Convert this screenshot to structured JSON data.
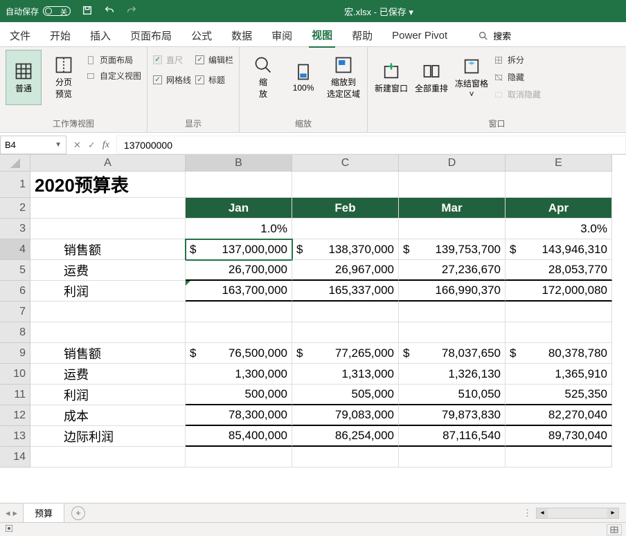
{
  "titleBar": {
    "autoSave": "自动保存",
    "autoSaveState": "关",
    "fileName": "宏.xlsx",
    "savedState": "已保存"
  },
  "tabs": {
    "items": [
      "文件",
      "开始",
      "插入",
      "页面布局",
      "公式",
      "数据",
      "审阅",
      "视图",
      "帮助",
      "Power Pivot"
    ],
    "activeIndex": 7,
    "searchLabel": "搜索"
  },
  "ribbon": {
    "workbookViews": {
      "normal": "普通",
      "pageBreak": "分页\n预览",
      "pageLayout": "页面布局",
      "customViews": "自定义视图",
      "groupLabel": "工作簿视图"
    },
    "show": {
      "ruler": "直尺",
      "formulaBar": "编辑栏",
      "gridlines": "网格线",
      "headings": "标题",
      "groupLabel": "显示"
    },
    "zoom": {
      "zoom": "缩\n放",
      "hundred": "100%",
      "toSelection": "缩放到\n选定区域",
      "groupLabel": "缩放"
    },
    "window": {
      "newWindow": "新建窗口",
      "arrangeAll": "全部重排",
      "freezePanes": "冻结窗格",
      "split": "拆分",
      "hide": "隐藏",
      "unhide": "取消隐藏",
      "groupLabel": "窗口"
    }
  },
  "formulaBar": {
    "nameBox": "B4",
    "formula": "137000000"
  },
  "grid": {
    "columns": [
      "A",
      "B",
      "C",
      "D",
      "E"
    ],
    "title": "2020预算表",
    "months": [
      "Jan",
      "Feb",
      "Mar",
      "Apr"
    ],
    "rowLabels": {
      "sales": "销售额",
      "shipping": "运费",
      "profit": "利润",
      "cost": "成本",
      "marginProfit": "边际利润"
    },
    "percents": {
      "B3": "1.0%",
      "E3": "3.0%"
    },
    "block1": {
      "sales": [
        "137,000,000",
        "138,370,000",
        "139,753,700",
        "143,946,310"
      ],
      "shipping": [
        "26,700,000",
        "26,967,000",
        "27,236,670",
        "28,053,770"
      ],
      "profit": [
        "163,700,000",
        "165,337,000",
        "166,990,370",
        "172,000,080"
      ]
    },
    "block2": {
      "sales": [
        "76,500,000",
        "77,265,000",
        "78,037,650",
        "80,378,780"
      ],
      "shipping": [
        "1,300,000",
        "1,313,000",
        "1,326,130",
        "1,365,910"
      ],
      "profit": [
        "500,000",
        "505,000",
        "510,050",
        "525,350"
      ],
      "cost": [
        "78,300,000",
        "79,083,000",
        "79,873,830",
        "82,270,040"
      ],
      "margin": [
        "85,400,000",
        "86,254,000",
        "87,116,540",
        "89,730,040"
      ]
    },
    "dollar": "$"
  },
  "sheetBar": {
    "sheetName": "预算"
  }
}
